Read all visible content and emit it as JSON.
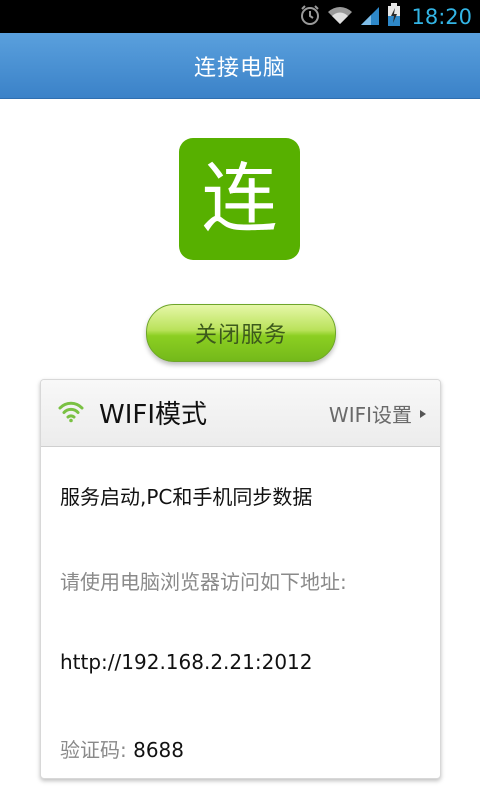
{
  "status_bar": {
    "time": "18:20",
    "icons": [
      "alarm-icon",
      "wifi-icon",
      "signal-icon",
      "battery-charging-icon"
    ],
    "time_color": "#33b5e5"
  },
  "title_bar": {
    "title": "连接电脑",
    "color": "#3b82c8"
  },
  "logo": {
    "glyph": "连",
    "color": "#57b000"
  },
  "service_button": {
    "label": "关闭服务"
  },
  "card": {
    "mode_title": "WIFI模式",
    "settings_link": "WIFI设置",
    "status_text": "服务启动,PC和手机同步数据",
    "hint_text": "请使用电脑浏览器访问如下地址:",
    "url": "http://192.168.2.21:2012",
    "code_label": "验证码: ",
    "code_value": "8688",
    "wifi_color": "#7ac143"
  }
}
